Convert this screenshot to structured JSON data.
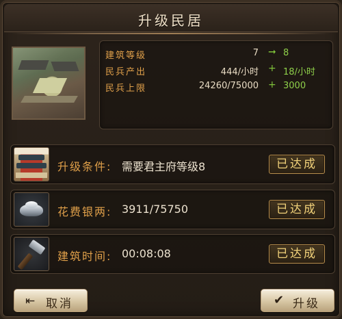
{
  "dialog": {
    "title": "升级民居",
    "watermark": ""
  },
  "stats": [
    {
      "label": "建筑等级",
      "current": "7",
      "op": "➞",
      "next": "8"
    },
    {
      "label": "民兵产出",
      "current": "444/小时",
      "op": "+",
      "next": "18/小时"
    },
    {
      "label": "民兵上限",
      "current": "24260/75000",
      "op": "+",
      "next": "3000"
    }
  ],
  "requirements": [
    {
      "label": "升级条件:",
      "value": "需要君主府等级8",
      "status": "已达成",
      "icon": "palace-icon"
    },
    {
      "label": "花费银两:",
      "value": "3911/75750",
      "status": "已达成",
      "icon": "silver-ingot-icon"
    },
    {
      "label": "建筑时间:",
      "value": "00:08:08",
      "status": "已达成",
      "icon": "hammer-icon"
    }
  ],
  "buttons": {
    "cancel": "取消",
    "upgrade": "升级",
    "cancel_icon": "exit-arrow-icon",
    "upgrade_icon": "checkmark-icon"
  },
  "colors": {
    "accent_label": "#e0a04a",
    "increase_green": "#8fd04a",
    "status_gold": "#f2d27a"
  }
}
